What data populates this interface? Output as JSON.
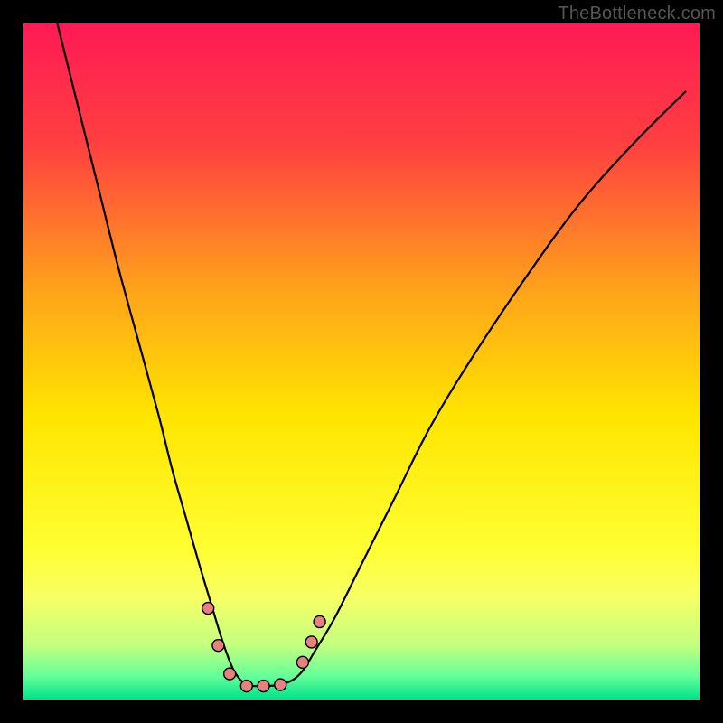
{
  "watermark": {
    "text": "TheBottleneck.com"
  },
  "chart_data": {
    "type": "line",
    "title": "",
    "xlabel": "",
    "ylabel": "",
    "xlim": [
      0,
      100
    ],
    "ylim": [
      0,
      100
    ],
    "grid": false,
    "background_gradient": {
      "stops": [
        {
          "offset": 0.0,
          "color": "#ff1a55"
        },
        {
          "offset": 0.18,
          "color": "#ff4040"
        },
        {
          "offset": 0.4,
          "color": "#ffa51a"
        },
        {
          "offset": 0.58,
          "color": "#ffe500"
        },
        {
          "offset": 0.78,
          "color": "#ffff33"
        },
        {
          "offset": 0.85,
          "color": "#f7ff66"
        },
        {
          "offset": 0.92,
          "color": "#c2ff80"
        },
        {
          "offset": 0.965,
          "color": "#66ff99"
        },
        {
          "offset": 1.0,
          "color": "#00e28a"
        }
      ]
    },
    "series": [
      {
        "name": "bottleneck-curve",
        "color": "#000000",
        "width": 2.2,
        "x": [
          5,
          8,
          11,
          14,
          17,
          20,
          22,
          24,
          26,
          27.5,
          29,
          30,
          31,
          32,
          33,
          34,
          36,
          38,
          40,
          41.5,
          43,
          46,
          50,
          55,
          60,
          66,
          74,
          82,
          90,
          98
        ],
        "y": [
          100,
          88,
          76,
          64,
          53,
          42,
          34,
          27,
          20,
          15,
          10,
          7,
          4.5,
          3,
          2.2,
          2,
          2,
          2.2,
          3,
          4.5,
          7,
          12,
          20,
          30,
          40,
          50,
          62,
          73,
          82,
          90
        ]
      }
    ],
    "markers": {
      "color": "#e98080",
      "stroke": "#000000",
      "radius": 6.5,
      "points": [
        {
          "x": 27.3,
          "y": 13.5
        },
        {
          "x": 28.8,
          "y": 8.0
        },
        {
          "x": 30.5,
          "y": 3.8
        },
        {
          "x": 33.0,
          "y": 2.0
        },
        {
          "x": 35.5,
          "y": 2.0
        },
        {
          "x": 38.0,
          "y": 2.2
        },
        {
          "x": 41.3,
          "y": 5.5
        },
        {
          "x": 42.6,
          "y": 8.5
        },
        {
          "x": 43.8,
          "y": 11.5
        }
      ]
    }
  }
}
